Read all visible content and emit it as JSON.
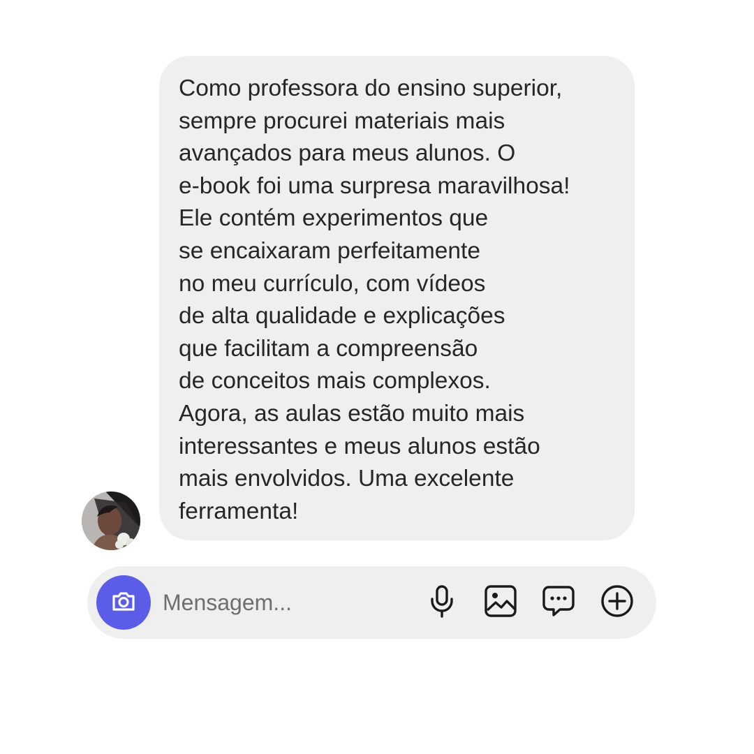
{
  "message": {
    "lines": [
      "Como professora do ensino superior,",
      "sempre procurei materiais mais",
      "avançados para meus alunos. O",
      "e-book foi uma surpresa maravilhosa!",
      "Ele contém experimentos que",
      "se encaixaram perfeitamente",
      "no meu currículo, com vídeos",
      "de alta qualidade e explicações",
      "que facilitam a compreensão",
      "de conceitos mais complexos.",
      "Agora, as aulas estão muito mais",
      "interessantes e meus alunos estão",
      "mais envolvidos. Uma excelente",
      "ferramenta!"
    ]
  },
  "composer": {
    "placeholder": "Mensagem...",
    "value": "",
    "icons": {
      "camera": "camera-icon",
      "microphone": "microphone-icon",
      "gallery": "image-icon",
      "sticker": "chat-bubble-icon",
      "more": "plus-circle-icon"
    }
  },
  "colors": {
    "bubble": "#efefef",
    "text": "#262626",
    "placeholder": "#6e6e6e",
    "camera_button": "#5b5de8",
    "icon": "#1a1a1a"
  }
}
